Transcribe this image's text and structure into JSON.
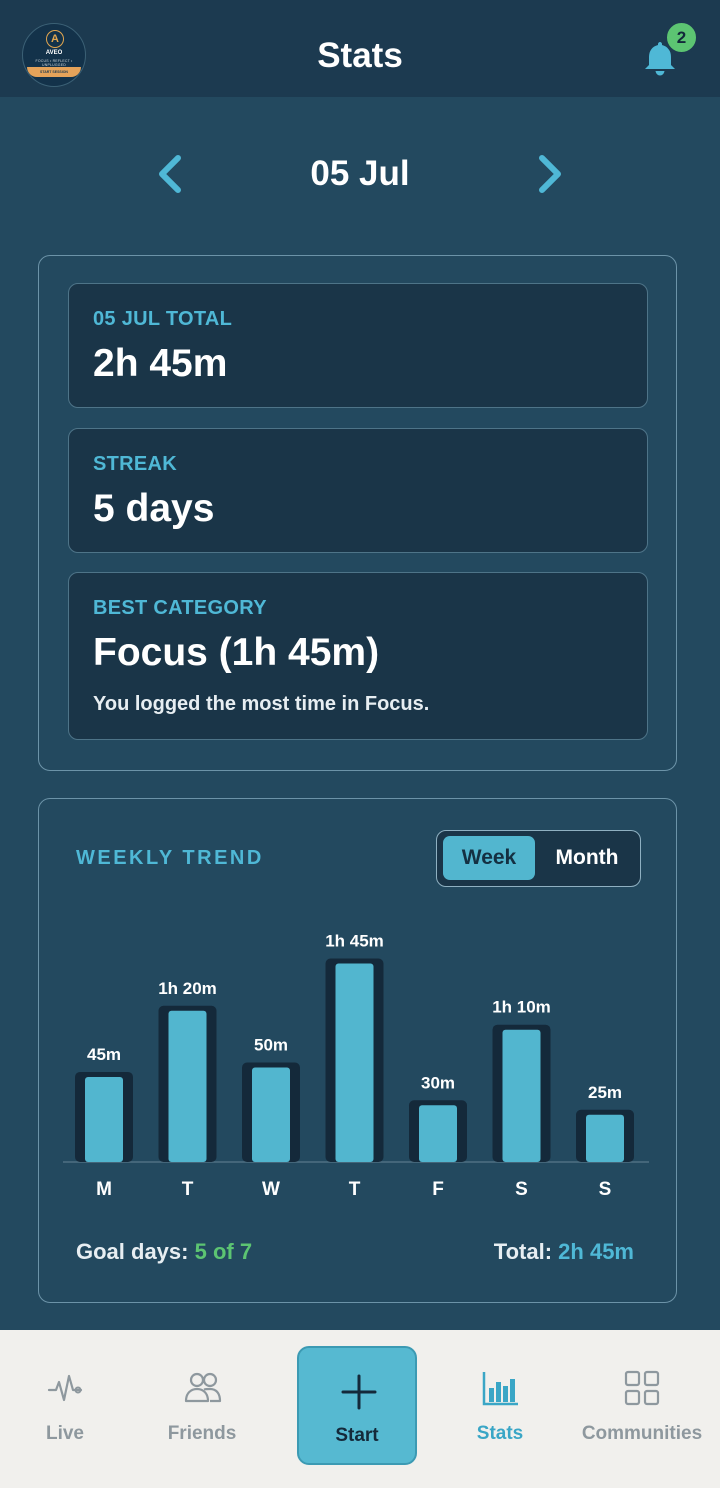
{
  "header": {
    "title": "Stats",
    "logo": {
      "letter": "A",
      "name": "AVEO",
      "tagline": "FOCUS • REFLECT • UNPLUGGED",
      "ribbon": "START SESSION"
    },
    "notifications_count": "2"
  },
  "date_nav": {
    "label": "05 Jul"
  },
  "summary": {
    "total": {
      "label": "05 JUL TOTAL",
      "value": "2h 45m"
    },
    "streak": {
      "label": "STREAK",
      "value": "5 days"
    },
    "best": {
      "label": "BEST CATEGORY",
      "value": "Focus (1h 45m)",
      "note": "You logged the most time in Focus."
    }
  },
  "trend": {
    "title": "WEEKLY TREND",
    "toggle": {
      "week": "Week",
      "month": "Month",
      "selected": "Week"
    },
    "goal_label": "Goal days:",
    "goal_value": "5 of 7",
    "total_label": "Total:",
    "total_value": "2h 45m"
  },
  "chart_data": {
    "type": "bar",
    "categories": [
      "M",
      "T",
      "W",
      "T",
      "F",
      "S",
      "S"
    ],
    "values": [
      45,
      80,
      50,
      105,
      30,
      70,
      25
    ],
    "value_labels": [
      "45m",
      "1h 20m",
      "50m",
      "1h 45m",
      "30m",
      "1h 10m",
      "25m"
    ],
    "unit": "minutes",
    "title": "",
    "xlabel": "",
    "ylabel": "",
    "grid": false,
    "colors": {
      "bar": "#52b6cf",
      "bar_bg": "#14293a"
    }
  },
  "bottom_nav": {
    "items": [
      {
        "label": "Live",
        "icon": "pulse-icon"
      },
      {
        "label": "Friends",
        "icon": "people-icon"
      },
      {
        "label": "Start",
        "icon": "plus-icon"
      },
      {
        "label": "Stats",
        "icon": "bar-chart-icon",
        "active": true
      },
      {
        "label": "Communities",
        "icon": "grid-icon"
      }
    ]
  },
  "colors": {
    "background": "#23495f",
    "header": "#1c3a50",
    "accent": "#4fb8d6",
    "goal": "#5cc472",
    "nav_bg": "#f1f0ed"
  }
}
